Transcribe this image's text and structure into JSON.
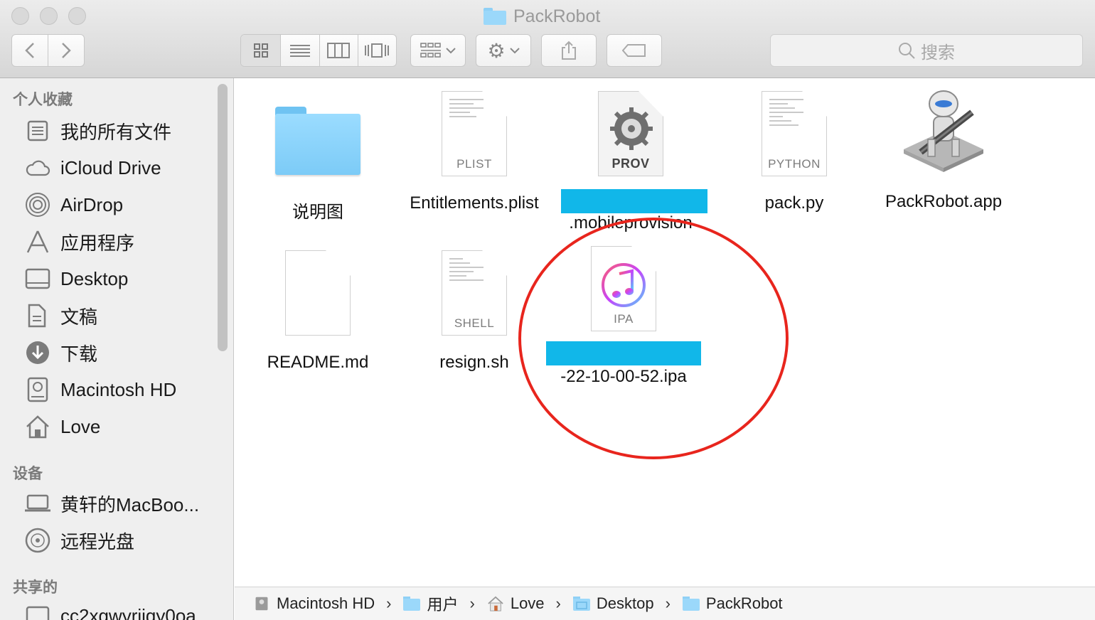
{
  "window": {
    "title": "PackRobot"
  },
  "toolbar": {
    "back_icon": "chevron-left-icon",
    "forward_icon": "chevron-right-icon",
    "view_modes": [
      "icon-view",
      "list-view",
      "column-view",
      "cover-flow-view"
    ],
    "search_placeholder": "搜索"
  },
  "sidebar": {
    "sections": [
      {
        "title": "个人收藏",
        "items": [
          {
            "label": "我的所有文件",
            "icon": "all-files-icon"
          },
          {
            "label": "iCloud Drive",
            "icon": "cloud-icon"
          },
          {
            "label": "AirDrop",
            "icon": "airdrop-icon"
          },
          {
            "label": "应用程序",
            "icon": "applications-icon"
          },
          {
            "label": "Desktop",
            "icon": "desktop-icon"
          },
          {
            "label": "文稿",
            "icon": "documents-icon"
          },
          {
            "label": "下载",
            "icon": "downloads-icon"
          },
          {
            "label": "Macintosh HD",
            "icon": "hard-drive-icon"
          },
          {
            "label": "Love",
            "icon": "home-icon"
          }
        ]
      },
      {
        "title": "设备",
        "items": [
          {
            "label": "黄轩的MacBoo...",
            "icon": "laptop-icon"
          },
          {
            "label": "远程光盘",
            "icon": "disc-icon"
          }
        ]
      },
      {
        "title": "共享的",
        "items": [
          {
            "label": "cc2xgwyriiqy0oa",
            "icon": "computer-icon"
          }
        ]
      }
    ]
  },
  "files": [
    {
      "name": "说明图",
      "kind": "folder"
    },
    {
      "name": "Entitlements.plist",
      "kind": "doc",
      "tag": "PLIST"
    },
    {
      "name": ".mobileprovision",
      "kind": "prov",
      "tag": "PROV",
      "redacted": true
    },
    {
      "name": "pack.py",
      "kind": "doc",
      "tag": "PYTHON"
    },
    {
      "name": "PackRobot.app",
      "kind": "app"
    },
    {
      "name": "README.md",
      "kind": "doc",
      "tag": ""
    },
    {
      "name": "resign.sh",
      "kind": "doc",
      "tag": "SHELL"
    },
    {
      "name": "-22-10-00-52.ipa",
      "kind": "ipa",
      "tag": "IPA",
      "redacted": true
    }
  ],
  "pathbar": [
    {
      "label": "Macintosh HD",
      "icon": "hard-drive-icon"
    },
    {
      "label": "用户",
      "icon": "folder-icon"
    },
    {
      "label": "Love",
      "icon": "home-icon"
    },
    {
      "label": "Desktop",
      "icon": "folder-icon"
    },
    {
      "label": "PackRobot",
      "icon": "folder-icon"
    }
  ],
  "colors": {
    "redaction": "#11b7e9",
    "annotation_circle": "#e8251d",
    "folder": "#7ccbf7"
  }
}
